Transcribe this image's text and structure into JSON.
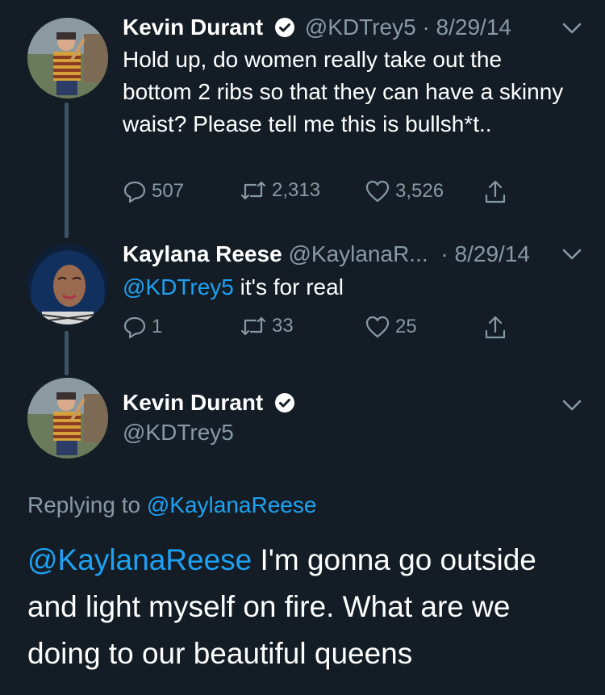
{
  "tweets": [
    {
      "name": "Kevin Durant",
      "handle": "@KDTrey5",
      "date": "· 8/29/14",
      "text": "Hold up, do women really take out the bottom 2 ribs so that they can have a skinny waist? Please tell me this is bullsh*t..",
      "replies": "507",
      "retweets": "2,313",
      "likes": "3,526"
    },
    {
      "name": "Kaylana Reese",
      "handle": "@KaylanaR...",
      "date": "· 8/29/14",
      "mention": "@KDTrey5",
      "text": " it's for real",
      "replies": "1",
      "retweets": "33",
      "likes": "25"
    },
    {
      "name": "Kevin Durant",
      "handle": "@KDTrey5",
      "replying_prefix": "Replying to ",
      "replying_handle": "@KaylanaReese",
      "mention": "@KaylanaReese",
      "text": " I'm gonna go outside and light myself on fire. What are we doing to our beautiful queens"
    }
  ],
  "colors": {
    "background": "#141d26",
    "link": "#1da1f2",
    "muted": "#8899a6"
  },
  "icons": [
    "verified-icon",
    "chevron-down-icon",
    "reply-icon",
    "retweet-icon",
    "like-icon",
    "share-icon"
  ]
}
